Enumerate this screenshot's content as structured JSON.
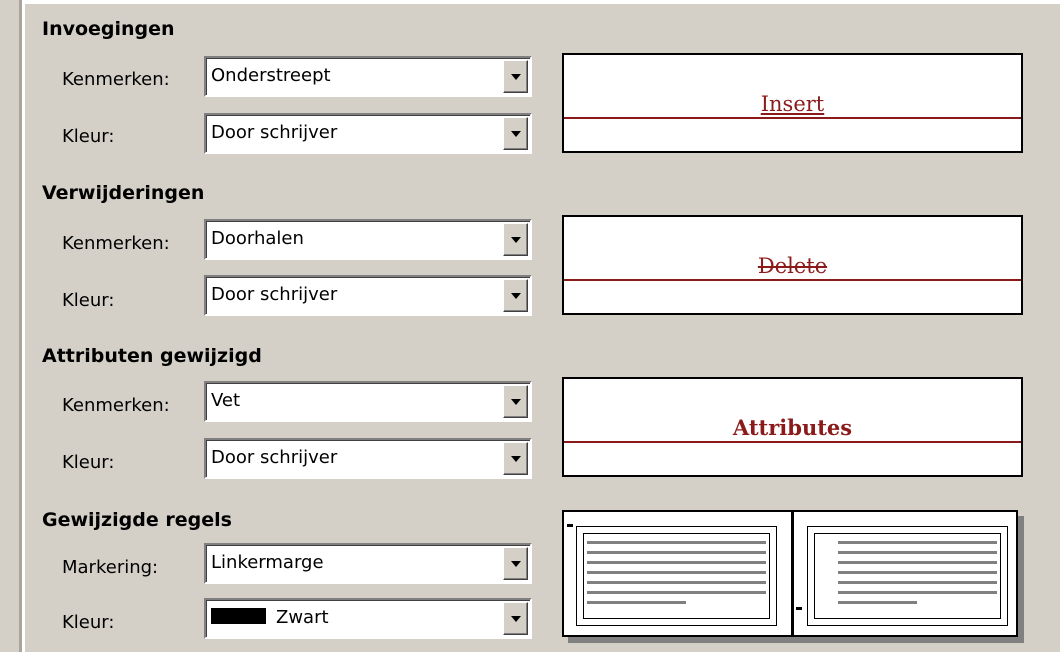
{
  "insertions": {
    "title": "Invoegingen",
    "attributes_label": "Kenmerken:",
    "attributes_value": "Onderstreept",
    "color_label": "Kleur:",
    "color_value": "Door schrijver",
    "preview_text": "Insert"
  },
  "deletions": {
    "title": "Verwijderingen",
    "attributes_label": "Kenmerken:",
    "attributes_value": "Doorhalen",
    "color_label": "Kleur:",
    "color_value": "Door schrijver",
    "preview_text": "Delete"
  },
  "changed_attributes": {
    "title": "Attributen gewijzigd",
    "attributes_label": "Kenmerken:",
    "attributes_value": "Vet",
    "color_label": "Kleur:",
    "color_value": "Door schrijver",
    "preview_text": "Attributes"
  },
  "changed_lines": {
    "title": "Gewijzigde regels",
    "mark_label": "Markering:",
    "mark_value": "Linkermarge",
    "color_label": "Kleur:",
    "color_value": "Zwart",
    "color_swatch": "#000000"
  },
  "colors": {
    "dialog_bg": "#d4d0c8",
    "preview_accent": "#8b1a1a"
  }
}
